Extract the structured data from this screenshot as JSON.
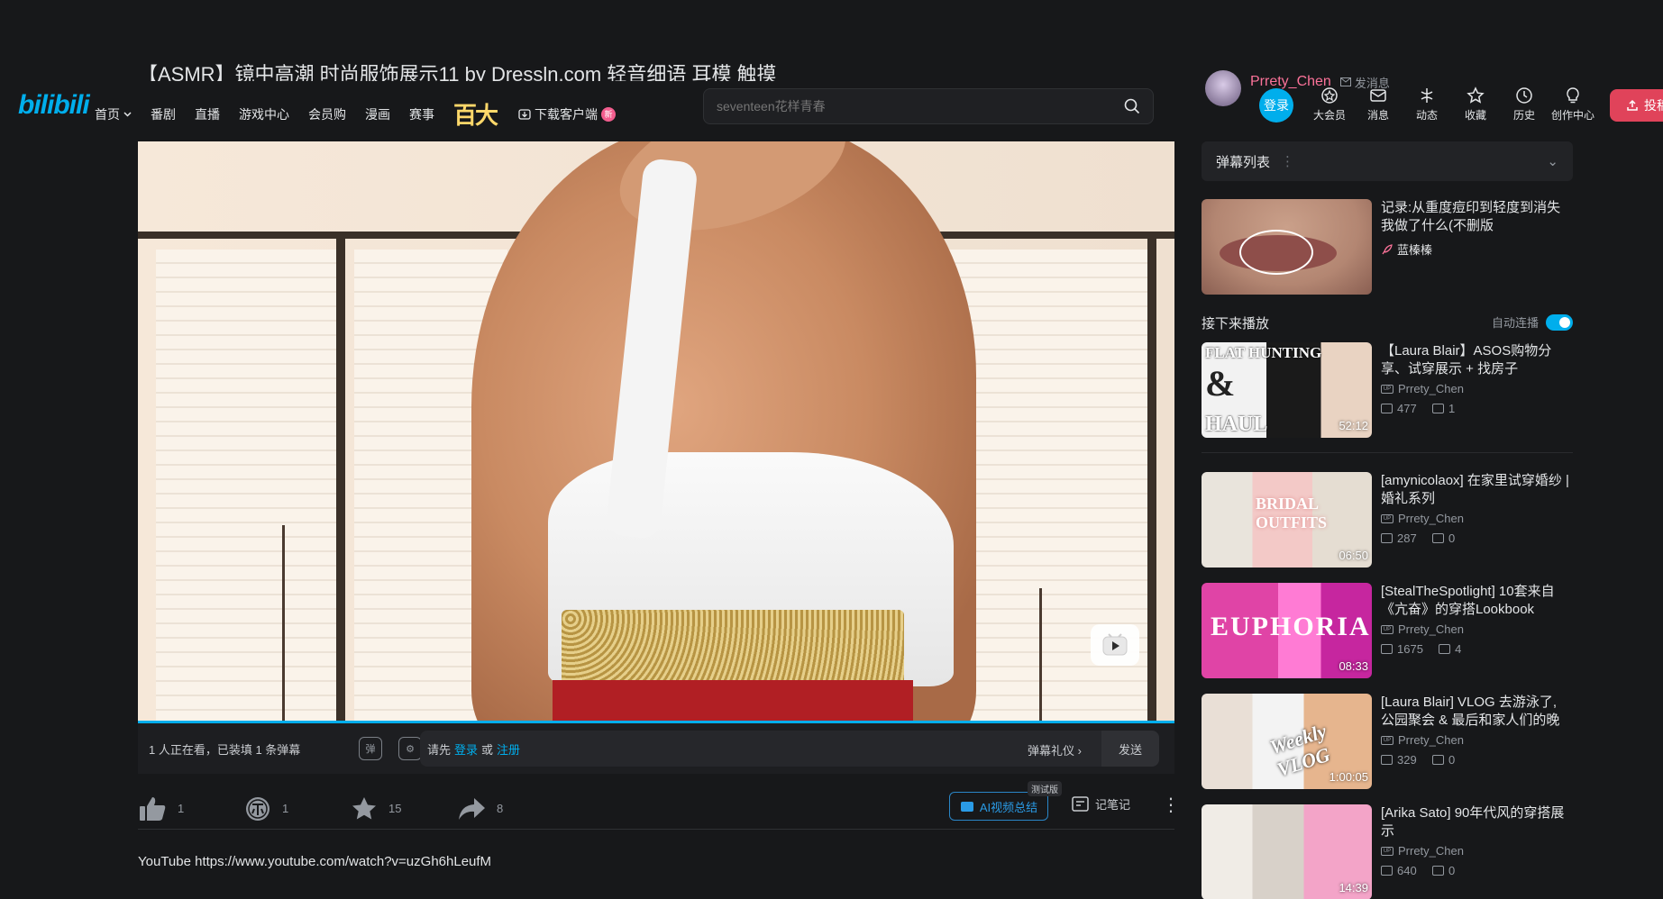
{
  "video": {
    "title": "【ASMR】镜中高潮 时尚服饰展示11 by Dressln.com 轻音细语 耳模 触摸",
    "description": "YouTube https://www.youtube.com/watch?v=uzGh6hLeufM"
  },
  "uploader": {
    "name": "Prrety_Chen",
    "message_label": "发消息"
  },
  "header": {
    "logo": "bilibili",
    "nav": [
      "首页",
      "番剧",
      "直播",
      "游戏中心",
      "会员购",
      "漫画",
      "赛事"
    ],
    "nav_special": "百大",
    "download_label": "下载客户端",
    "download_badge": "新",
    "search_placeholder": "seventeen花样青春",
    "login_label": "登录",
    "icons": [
      {
        "label": "大会员",
        "icon": "vip-icon"
      },
      {
        "label": "消息",
        "icon": "message-icon"
      },
      {
        "label": "动态",
        "icon": "dynamic-icon"
      },
      {
        "label": "收藏",
        "icon": "star-icon"
      },
      {
        "label": "历史",
        "icon": "history-icon"
      },
      {
        "label": "创作中心",
        "icon": "lightbulb-icon"
      }
    ],
    "upload_label": "投稿"
  },
  "danmaku_bar": {
    "info": "1 人正在看，已装填 1 条弹幕",
    "prompt_before": "请先",
    "login_link": "登录",
    "or": "或",
    "register_link": "注册",
    "etiquette": "弹幕礼仪",
    "send": "发送"
  },
  "actions": {
    "like": "1",
    "coin": "1",
    "favorite": "15",
    "share": "8",
    "ai_summary": "AI视频总结",
    "ai_tag": "测试版",
    "note": "记笔记"
  },
  "sidebar": {
    "danmaku_list": "弹幕列表",
    "ad": {
      "title": "记录:从重度痘印到轻度到消失我做了什么(不删版",
      "source": "蓝榛榛"
    },
    "next_play": "接下来播放",
    "autoplay": "自动连播",
    "recommendations": [
      {
        "title": "【Laura Blair】ASOS购物分享、试穿展示 + 找房子",
        "owner": "Prrety_Chen",
        "views": "477",
        "danmaku": "1",
        "duration": "52:12"
      },
      {
        "title": "[amynicolaox] 在家里试穿婚纱 | 婚礼系列",
        "owner": "Prrety_Chen",
        "views": "287",
        "danmaku": "0",
        "duration": "06:50"
      },
      {
        "title": "[StealTheSpotlight] 10套来自《亢奋》的穿搭Lookbook",
        "owner": "Prrety_Chen",
        "views": "1675",
        "danmaku": "4",
        "duration": "08:33"
      },
      {
        "title": "[Laura Blair] VLOG 去游泳了, 公园聚会 & 最后和家人们的晚餐",
        "owner": "Prrety_Chen",
        "views": "329",
        "danmaku": "0",
        "duration": "1:00:05"
      },
      {
        "title": "[Arika Sato] 90年代风的穿搭展示",
        "owner": "Prrety_Chen",
        "views": "640",
        "danmaku": "0",
        "duration": "14:39"
      }
    ],
    "thumb_texts": [
      "FLAT HUNTING",
      "&",
      "HAUL",
      "BRIDAL OUTFITS",
      "EUPHORIA",
      "Weekly VLOG"
    ]
  },
  "colors": {
    "accent": "#00aeec",
    "pink": "#fb7299",
    "upload": "#e0435a",
    "background": "#17181a"
  }
}
